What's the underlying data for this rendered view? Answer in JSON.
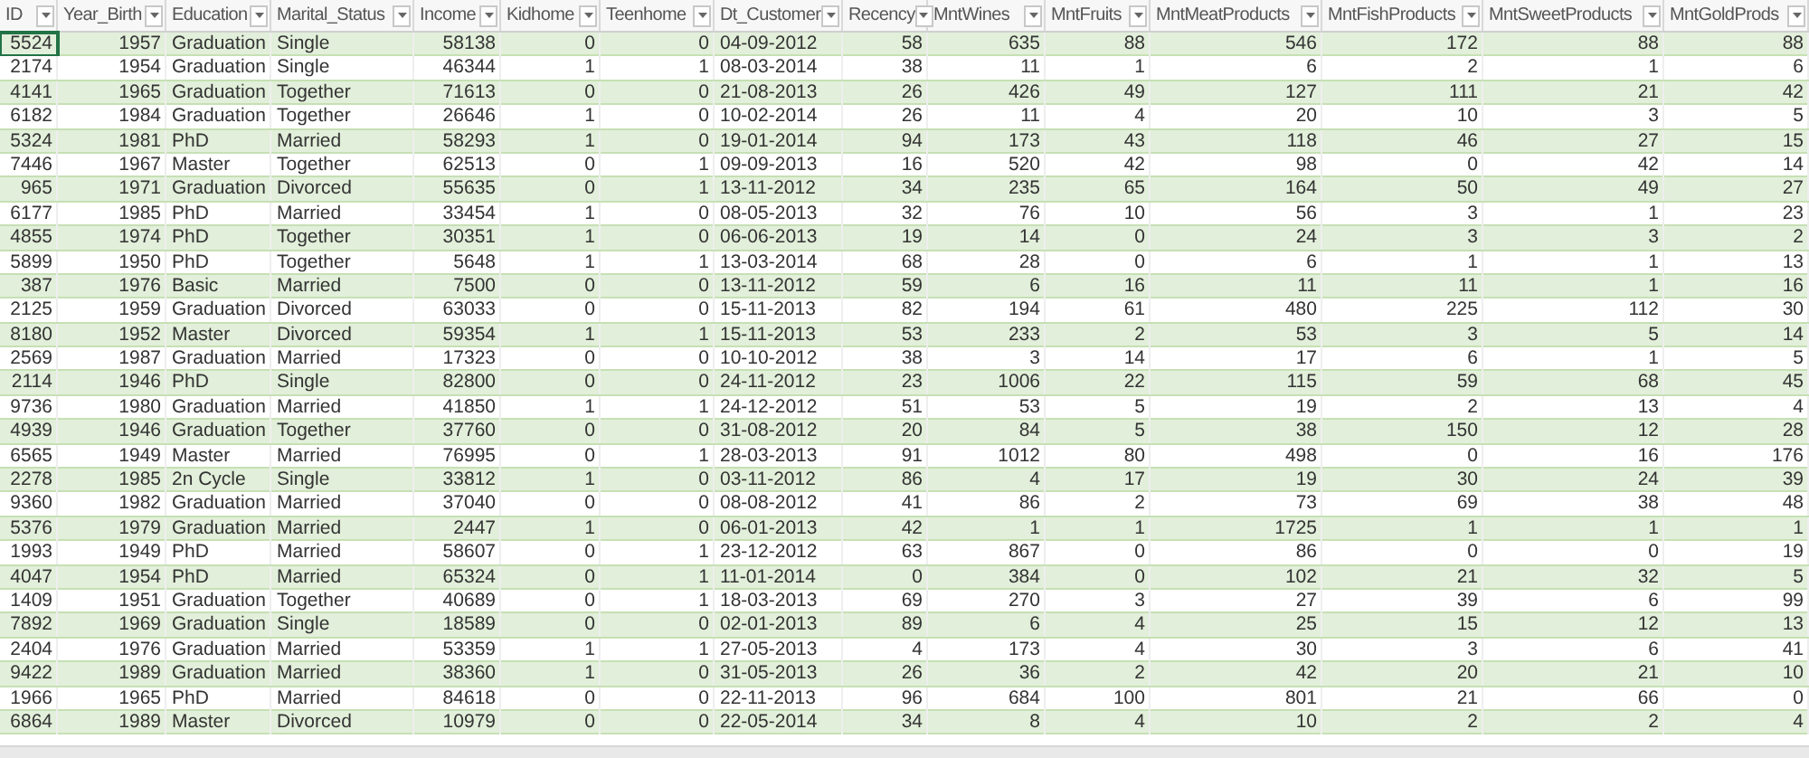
{
  "table": {
    "columns": [
      {
        "label": "ID",
        "kind": "number"
      },
      {
        "label": "Year_Birth",
        "kind": "number"
      },
      {
        "label": "Education",
        "kind": "text"
      },
      {
        "label": "Marital_Status",
        "kind": "text"
      },
      {
        "label": "Income",
        "kind": "number"
      },
      {
        "label": "Kidhome",
        "kind": "number"
      },
      {
        "label": "Teenhome",
        "kind": "number"
      },
      {
        "label": "Dt_Customer",
        "kind": "text"
      },
      {
        "label": "Recency",
        "kind": "number"
      },
      {
        "label": "MntWines",
        "kind": "number"
      },
      {
        "label": "MntFruits",
        "kind": "number"
      },
      {
        "label": "MntMeatProducts",
        "kind": "number"
      },
      {
        "label": "MntFishProducts",
        "kind": "number"
      },
      {
        "label": "MntSweetProducts",
        "kind": "number"
      },
      {
        "label": "MntGoldProds",
        "kind": "number"
      }
    ],
    "rows": [
      {
        "selected": true,
        "cells": [
          "5524",
          "1957",
          "Graduation",
          "Single",
          "58138",
          "0",
          "0",
          "04-09-2012",
          "58",
          "635",
          "88",
          "546",
          "172",
          "88",
          "88"
        ]
      },
      {
        "selected": false,
        "cells": [
          "2174",
          "1954",
          "Graduation",
          "Single",
          "46344",
          "1",
          "1",
          "08-03-2014",
          "38",
          "11",
          "1",
          "6",
          "2",
          "1",
          "6"
        ]
      },
      {
        "selected": false,
        "cells": [
          "4141",
          "1965",
          "Graduation",
          "Together",
          "71613",
          "0",
          "0",
          "21-08-2013",
          "26",
          "426",
          "49",
          "127",
          "111",
          "21",
          "42"
        ]
      },
      {
        "selected": false,
        "cells": [
          "6182",
          "1984",
          "Graduation",
          "Together",
          "26646",
          "1",
          "0",
          "10-02-2014",
          "26",
          "11",
          "4",
          "20",
          "10",
          "3",
          "5"
        ]
      },
      {
        "selected": false,
        "cells": [
          "5324",
          "1981",
          "PhD",
          "Married",
          "58293",
          "1",
          "0",
          "19-01-2014",
          "94",
          "173",
          "43",
          "118",
          "46",
          "27",
          "15"
        ]
      },
      {
        "selected": false,
        "cells": [
          "7446",
          "1967",
          "Master",
          "Together",
          "62513",
          "0",
          "1",
          "09-09-2013",
          "16",
          "520",
          "42",
          "98",
          "0",
          "42",
          "14"
        ]
      },
      {
        "selected": false,
        "cells": [
          "965",
          "1971",
          "Graduation",
          "Divorced",
          "55635",
          "0",
          "1",
          "13-11-2012",
          "34",
          "235",
          "65",
          "164",
          "50",
          "49",
          "27"
        ]
      },
      {
        "selected": false,
        "cells": [
          "6177",
          "1985",
          "PhD",
          "Married",
          "33454",
          "1",
          "0",
          "08-05-2013",
          "32",
          "76",
          "10",
          "56",
          "3",
          "1",
          "23"
        ]
      },
      {
        "selected": false,
        "cells": [
          "4855",
          "1974",
          "PhD",
          "Together",
          "30351",
          "1",
          "0",
          "06-06-2013",
          "19",
          "14",
          "0",
          "24",
          "3",
          "3",
          "2"
        ]
      },
      {
        "selected": false,
        "cells": [
          "5899",
          "1950",
          "PhD",
          "Together",
          "5648",
          "1",
          "1",
          "13-03-2014",
          "68",
          "28",
          "0",
          "6",
          "1",
          "1",
          "13"
        ]
      },
      {
        "selected": false,
        "cells": [
          "387",
          "1976",
          "Basic",
          "Married",
          "7500",
          "0",
          "0",
          "13-11-2012",
          "59",
          "6",
          "16",
          "11",
          "11",
          "1",
          "16"
        ]
      },
      {
        "selected": false,
        "cells": [
          "2125",
          "1959",
          "Graduation",
          "Divorced",
          "63033",
          "0",
          "0",
          "15-11-2013",
          "82",
          "194",
          "61",
          "480",
          "225",
          "112",
          "30"
        ]
      },
      {
        "selected": false,
        "cells": [
          "8180",
          "1952",
          "Master",
          "Divorced",
          "59354",
          "1",
          "1",
          "15-11-2013",
          "53",
          "233",
          "2",
          "53",
          "3",
          "5",
          "14"
        ]
      },
      {
        "selected": false,
        "cells": [
          "2569",
          "1987",
          "Graduation",
          "Married",
          "17323",
          "0",
          "0",
          "10-10-2012",
          "38",
          "3",
          "14",
          "17",
          "6",
          "1",
          "5"
        ]
      },
      {
        "selected": false,
        "cells": [
          "2114",
          "1946",
          "PhD",
          "Single",
          "82800",
          "0",
          "0",
          "24-11-2012",
          "23",
          "1006",
          "22",
          "115",
          "59",
          "68",
          "45"
        ]
      },
      {
        "selected": false,
        "cells": [
          "9736",
          "1980",
          "Graduation",
          "Married",
          "41850",
          "1",
          "1",
          "24-12-2012",
          "51",
          "53",
          "5",
          "19",
          "2",
          "13",
          "4"
        ]
      },
      {
        "selected": false,
        "cells": [
          "4939",
          "1946",
          "Graduation",
          "Together",
          "37760",
          "0",
          "0",
          "31-08-2012",
          "20",
          "84",
          "5",
          "38",
          "150",
          "12",
          "28"
        ]
      },
      {
        "selected": false,
        "cells": [
          "6565",
          "1949",
          "Master",
          "Married",
          "76995",
          "0",
          "1",
          "28-03-2013",
          "91",
          "1012",
          "80",
          "498",
          "0",
          "16",
          "176"
        ]
      },
      {
        "selected": false,
        "cells": [
          "2278",
          "1985",
          "2n Cycle",
          "Single",
          "33812",
          "1",
          "0",
          "03-11-2012",
          "86",
          "4",
          "17",
          "19",
          "30",
          "24",
          "39"
        ]
      },
      {
        "selected": false,
        "cells": [
          "9360",
          "1982",
          "Graduation",
          "Married",
          "37040",
          "0",
          "0",
          "08-08-2012",
          "41",
          "86",
          "2",
          "73",
          "69",
          "38",
          "48"
        ]
      },
      {
        "selected": false,
        "cells": [
          "5376",
          "1979",
          "Graduation",
          "Married",
          "2447",
          "1",
          "0",
          "06-01-2013",
          "42",
          "1",
          "1",
          "1725",
          "1",
          "1",
          "1"
        ]
      },
      {
        "selected": false,
        "cells": [
          "1993",
          "1949",
          "PhD",
          "Married",
          "58607",
          "0",
          "1",
          "23-12-2012",
          "63",
          "867",
          "0",
          "86",
          "0",
          "0",
          "19"
        ]
      },
      {
        "selected": false,
        "cells": [
          "4047",
          "1954",
          "PhD",
          "Married",
          "65324",
          "0",
          "1",
          "11-01-2014",
          "0",
          "384",
          "0",
          "102",
          "21",
          "32",
          "5"
        ]
      },
      {
        "selected": false,
        "cells": [
          "1409",
          "1951",
          "Graduation",
          "Together",
          "40689",
          "0",
          "1",
          "18-03-2013",
          "69",
          "270",
          "3",
          "27",
          "39",
          "6",
          "99"
        ]
      },
      {
        "selected": false,
        "cells": [
          "7892",
          "1969",
          "Graduation",
          "Single",
          "18589",
          "0",
          "0",
          "02-01-2013",
          "89",
          "6",
          "4",
          "25",
          "15",
          "12",
          "13"
        ]
      },
      {
        "selected": false,
        "cells": [
          "2404",
          "1976",
          "Graduation",
          "Married",
          "53359",
          "1",
          "1",
          "27-05-2013",
          "4",
          "173",
          "4",
          "30",
          "3",
          "6",
          "41"
        ]
      },
      {
        "selected": false,
        "cells": [
          "9422",
          "1989",
          "Graduation",
          "Married",
          "38360",
          "1",
          "0",
          "31-05-2013",
          "26",
          "36",
          "2",
          "42",
          "20",
          "21",
          "10"
        ]
      },
      {
        "selected": false,
        "cells": [
          "1966",
          "1965",
          "PhD",
          "Married",
          "84618",
          "0",
          "0",
          "22-11-2013",
          "96",
          "684",
          "100",
          "801",
          "21",
          "66",
          "0"
        ]
      },
      {
        "selected": false,
        "cells": [
          "6864",
          "1989",
          "Master",
          "Divorced",
          "10979",
          "0",
          "0",
          "22-05-2014",
          "34",
          "8",
          "4",
          "10",
          "2",
          "2",
          "4"
        ]
      }
    ]
  }
}
